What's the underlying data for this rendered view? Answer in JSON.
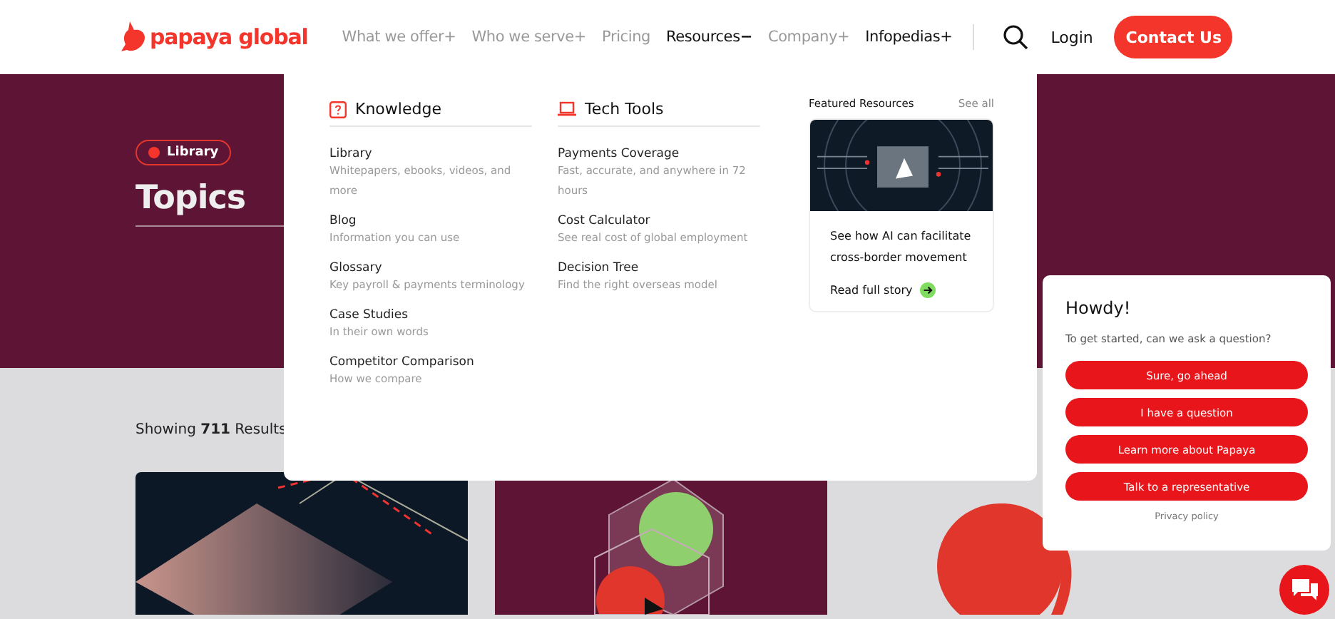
{
  "header": {
    "logo": "papaya global",
    "nav": [
      {
        "label": "What we offer",
        "sign": "+",
        "expanded": false,
        "highlighted": false
      },
      {
        "label": "Who we serve",
        "sign": "+",
        "expanded": false,
        "highlighted": false
      },
      {
        "label": "Pricing",
        "highlighted": false
      },
      {
        "label": "Resources",
        "sign": "−",
        "expanded": true,
        "highlighted": true
      },
      {
        "label": "Company",
        "sign": "+",
        "expanded": false,
        "highlighted": false
      },
      {
        "label": "Infopedias",
        "sign": "+",
        "expanded": false,
        "highlighted": true
      }
    ],
    "login": "Login",
    "contact": "Contact Us"
  },
  "hero": {
    "badge": "Library",
    "title": "Topics"
  },
  "results": "Showing **711** Results",
  "dropdown": {
    "columns": [
      {
        "title": "Knowledge",
        "kind": "question",
        "items": [
          {
            "label": "Library",
            "desc": "Whitepapers, ebooks, videos, and more"
          },
          {
            "label": "Blog",
            "desc": "Information you can use"
          },
          {
            "label": "Glossary",
            "desc": "Key payroll & payments terminology"
          },
          {
            "label": "Case Studies",
            "desc": "In their own words"
          },
          {
            "label": "Competitor Comparison",
            "desc": "How we compare"
          }
        ]
      },
      {
        "title": "Tech Tools",
        "kind": "laptop",
        "items": [
          {
            "label": "Payments Coverage",
            "desc": "Fast, accurate, and anywhere in 72 hours"
          },
          {
            "label": "Cost Calculator",
            "desc": "See real cost of global employment"
          },
          {
            "label": "Decision Tree",
            "desc": "Find the right overseas model"
          }
        ]
      }
    ],
    "featured": {
      "title": "Featured Resources",
      "see_all": "See all",
      "card_title": "See how AI can facilitate cross-border movement",
      "link": "Read full story"
    }
  },
  "chat": {
    "title": "Howdy!",
    "prompt": "To get started, can we ask a question?",
    "options": [
      "Sure, go ahead",
      "I have a question",
      "Learn more about Papaya",
      "Talk to a representative"
    ],
    "privacy": "Privacy policy"
  }
}
